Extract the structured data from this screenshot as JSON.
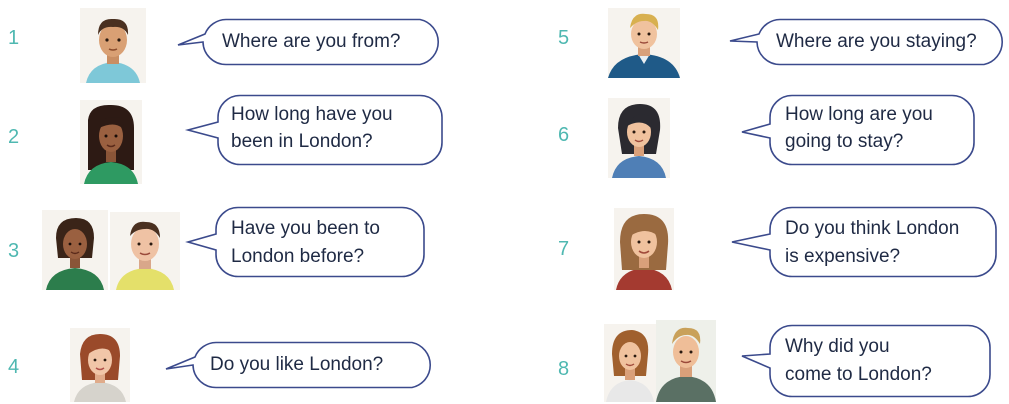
{
  "questions": [
    {
      "number": "1",
      "text": "Where are you from?"
    },
    {
      "number": "2",
      "line1": "How long have you",
      "line2": "been in London?"
    },
    {
      "number": "3",
      "line1": "Have you been to",
      "line2": "London before?"
    },
    {
      "number": "4",
      "text": "Do you like London?"
    },
    {
      "number": "5",
      "text": "Where are you staying?"
    },
    {
      "number": "6",
      "line1": "How long are you",
      "line2": "going to stay?"
    },
    {
      "number": "7",
      "line1": "Do you think London",
      "line2": "is expensive?"
    },
    {
      "number": "8",
      "line1": "Why did you",
      "line2": "come to London?"
    }
  ],
  "colors": {
    "number": "#4fb8b1",
    "bubble_stroke": "#3b4a8c",
    "text": "#1f2a44"
  }
}
